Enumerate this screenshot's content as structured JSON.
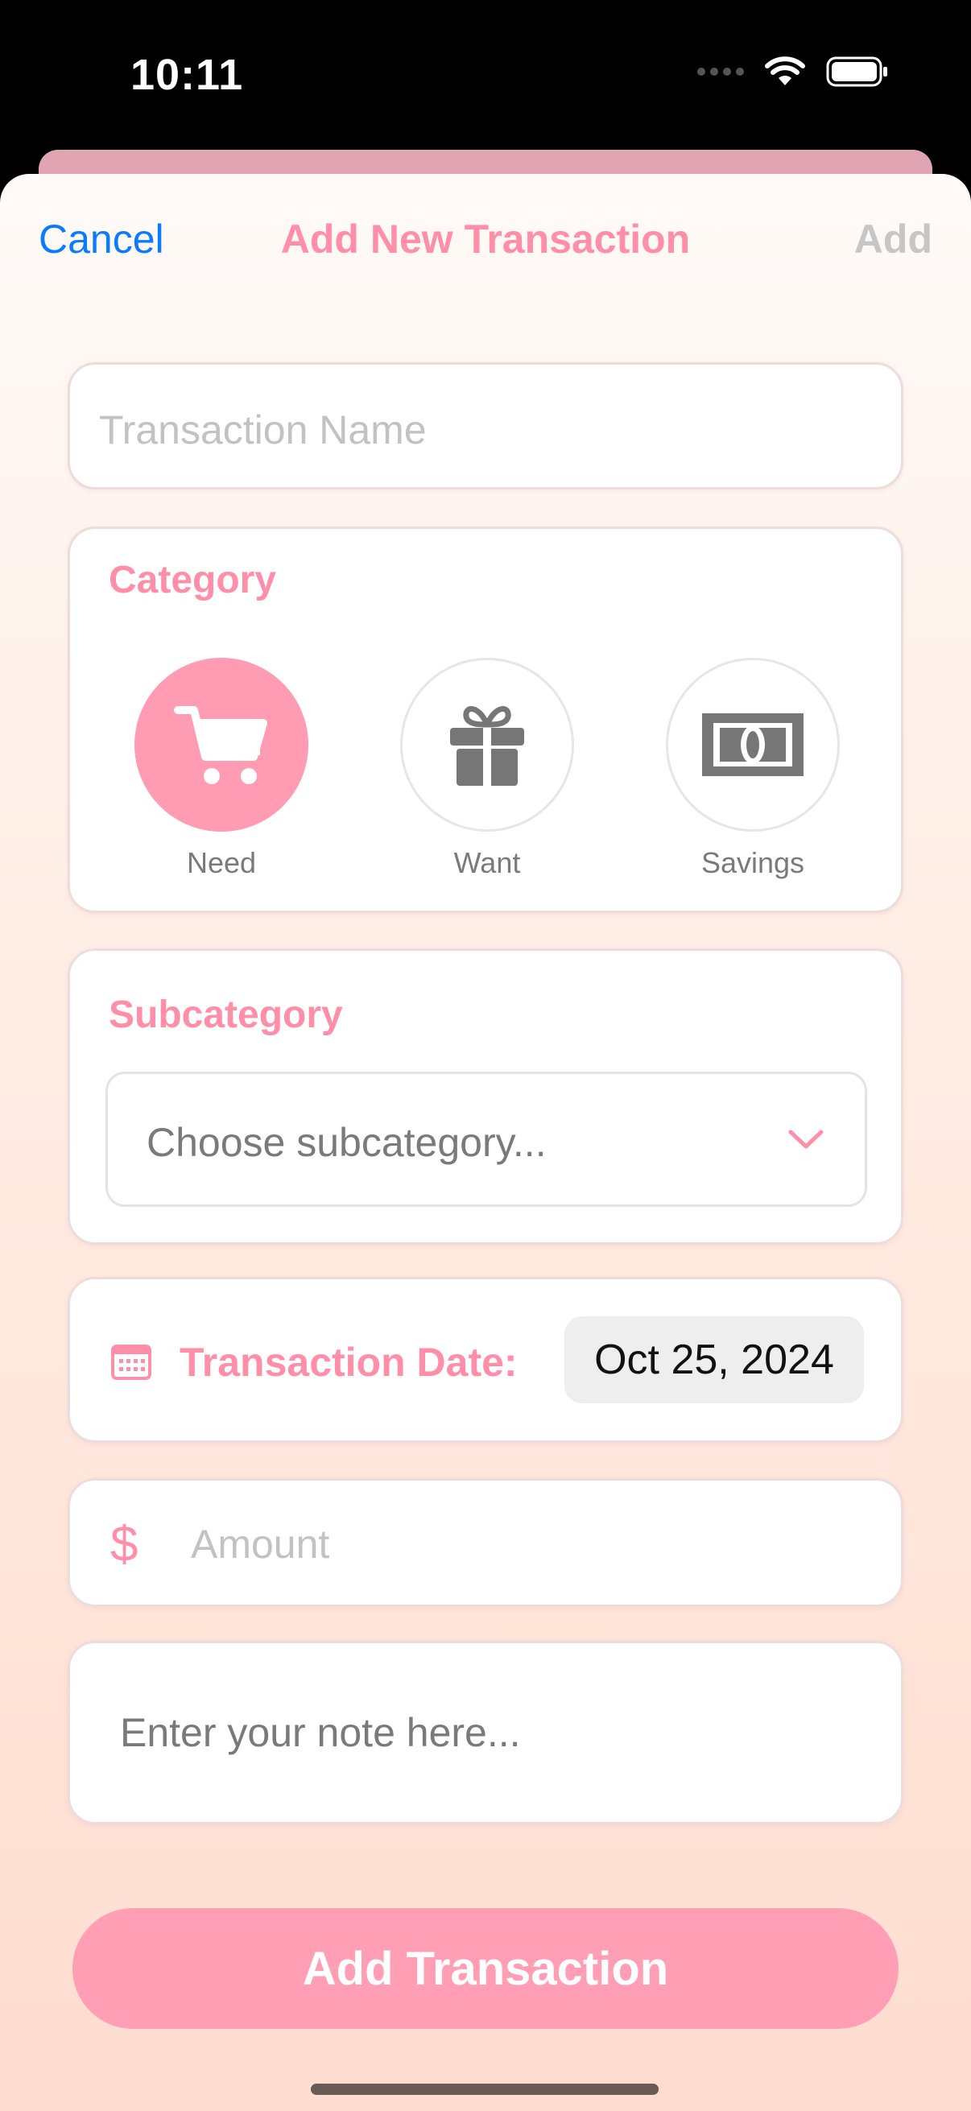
{
  "status_bar": {
    "time": "10:11"
  },
  "nav": {
    "cancel_label": "Cancel",
    "title": "Add New Transaction",
    "add_label": "Add"
  },
  "form": {
    "name_placeholder": "Transaction Name",
    "category": {
      "heading": "Category",
      "options": [
        {
          "label": "Need",
          "icon": "cart-icon",
          "selected": true
        },
        {
          "label": "Want",
          "icon": "gift-icon",
          "selected": false
        },
        {
          "label": "Savings",
          "icon": "banknote-icon",
          "selected": false
        }
      ]
    },
    "subcategory": {
      "heading": "Subcategory",
      "placeholder": "Choose subcategory..."
    },
    "date": {
      "label": "Transaction Date:",
      "value": "Oct 25, 2024"
    },
    "amount": {
      "currency_symbol": "$",
      "placeholder": "Amount"
    },
    "note_placeholder": "Enter your note here..."
  },
  "submit_label": "Add Transaction",
  "colors": {
    "accent_pink": "#ff8fa9",
    "button_pink": "#ff9eb5",
    "ios_blue": "#0a7aff"
  }
}
